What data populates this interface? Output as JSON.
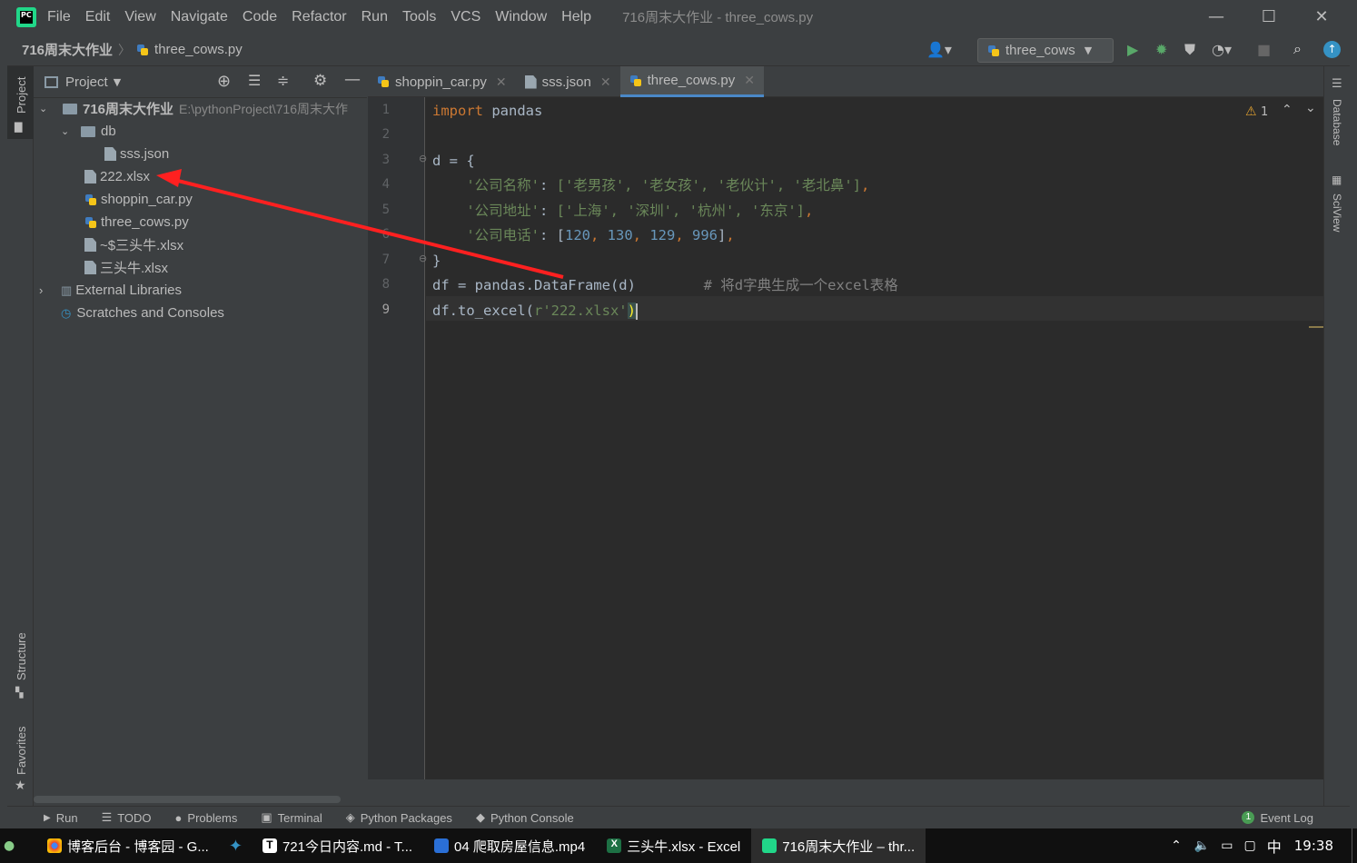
{
  "menubar": {
    "items": [
      "File",
      "Edit",
      "View",
      "Navigate",
      "Code",
      "Refactor",
      "Run",
      "Tools",
      "VCS",
      "Window",
      "Help"
    ],
    "window_title": "716周末大作业 - three_cows.py"
  },
  "navbar": {
    "project": "716周末大作业",
    "file": "three_cows.py",
    "run_config": "three_cows"
  },
  "project_panel": {
    "title": "Project",
    "tree": [
      {
        "label": "716周末大作业",
        "path": "E:\\pythonProject\\716周末大作"
      },
      {
        "label": "db"
      },
      {
        "label": "sss.json"
      },
      {
        "label": "222.xlsx"
      },
      {
        "label": "shoppin_car.py"
      },
      {
        "label": "three_cows.py"
      },
      {
        "label": "~$三头牛.xlsx"
      },
      {
        "label": "三头牛.xlsx"
      },
      {
        "label": "External Libraries"
      },
      {
        "label": "Scratches and Consoles"
      }
    ]
  },
  "left_strip": {
    "project": "Project",
    "structure": "Structure",
    "favorites": "Favorites"
  },
  "right_strip": {
    "database": "Database",
    "sciview": "SciView"
  },
  "editor": {
    "tabs": [
      {
        "label": "shoppin_car.py"
      },
      {
        "label": "sss.json"
      },
      {
        "label": "three_cows.py"
      }
    ],
    "warning_count": "1",
    "line_numbers": [
      "1",
      "2",
      "3",
      "4",
      "5",
      "6",
      "7",
      "8",
      "9"
    ],
    "code": {
      "l1_kw": "import",
      "l1_rest": " pandas",
      "l3": "d = {",
      "l4_key": "'公司名称'",
      "l4_vals": "['老男孩', '老女孩', '老伙计', '老北鼻']",
      "l5_key": "'公司地址'",
      "l5_vals": "['上海', '深圳', '杭州', '东京']",
      "l6_key": "'公司电话'",
      "l6_n1": "120",
      "l6_n2": "130",
      "l6_n3": "129",
      "l6_n4": "996",
      "l7": "}",
      "l8_code": "df = pandas.DataFrame(d)",
      "l8_comment": "# 将d字典生成一个excel表格",
      "l9_pre": "df.to_excel(",
      "l9_str": "r'222.xlsx'",
      "l9_post": ")"
    }
  },
  "bottom_bar": {
    "items": [
      "Run",
      "TODO",
      "Problems",
      "Terminal",
      "Python Packages",
      "Python Console"
    ],
    "event_log": "Event Log",
    "event_count": "1"
  },
  "taskbar": {
    "tasks": [
      "博客后台 - 博客园 - G...",
      "721今日内容.md - T...",
      "04 爬取房屋信息.mp4",
      "三头牛.xlsx - Excel",
      "716周末大作业 – thr..."
    ],
    "ime": "中",
    "clock": "19:38"
  },
  "colors": {
    "accent": "#4a88c7",
    "keyword": "#cc7832",
    "string": "#6a8759",
    "number": "#6897bb",
    "annotation_arrow": "#ff2020"
  }
}
